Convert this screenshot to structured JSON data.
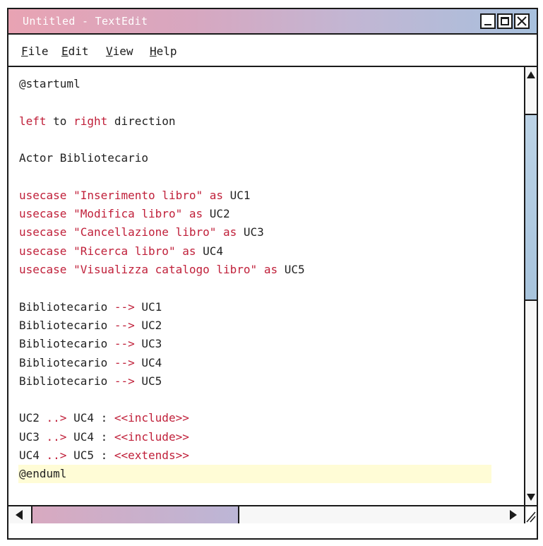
{
  "window": {
    "title": "Untitled - TextEdit"
  },
  "menu": {
    "file": {
      "mnemonic": "F",
      "rest": "ile"
    },
    "edit": {
      "mnemonic": "E",
      "rest": "dit"
    },
    "view": {
      "mnemonic": "V",
      "rest": "iew"
    },
    "help": {
      "mnemonic": "H",
      "rest": "elp"
    }
  },
  "editor": {
    "lines": [
      {
        "text": "@startuml"
      },
      {
        "text": ""
      },
      {
        "text": "left to right direction"
      },
      {
        "text": ""
      },
      {
        "text": "Actor Bibliotecario"
      },
      {
        "text": ""
      },
      {
        "text": "usecase \"Inserimento libro\" as UC1"
      },
      {
        "text": "usecase \"Modifica libro\" as UC2"
      },
      {
        "text": "usecase \"Cancellazione libro\" as UC3"
      },
      {
        "text": "usecase \"Ricerca libro\" as UC4"
      },
      {
        "text": "usecase \"Visualizza catalogo libro\" as UC5"
      },
      {
        "text": ""
      },
      {
        "text": "Bibliotecario --> UC1"
      },
      {
        "text": "Bibliotecario --> UC2"
      },
      {
        "text": "Bibliotecario --> UC3"
      },
      {
        "text": "Bibliotecario --> UC4"
      },
      {
        "text": "Bibliotecario --> UC5"
      },
      {
        "text": ""
      },
      {
        "text": "UC2 ..> UC4 : <<include>>"
      },
      {
        "text": "UC3 ..> UC4 : <<include>>"
      },
      {
        "text": "UC4 ..> UC5 : <<extends>>"
      },
      {
        "text": "@enduml"
      }
    ],
    "highlighted_line": 21
  },
  "colors": {
    "keyword": "#c0203a",
    "highlight": "#fffcd6"
  }
}
